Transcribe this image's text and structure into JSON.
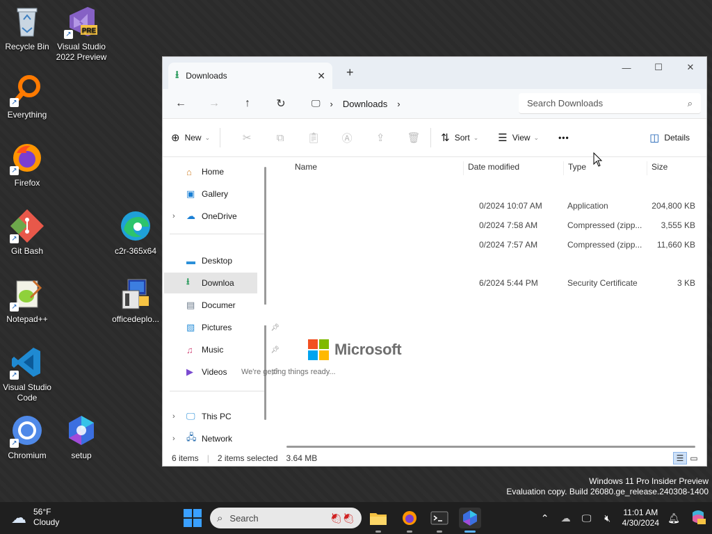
{
  "desktop": {
    "icons": [
      {
        "label": "Recycle Bin",
        "icon": "recycle-bin-icon"
      },
      {
        "label": "Visual Studio 2022 Preview",
        "icon": "visual-studio-icon",
        "badge": "PRE"
      },
      {
        "label": "Everything",
        "icon": "everything-search-icon"
      },
      {
        "label": "Firefox",
        "icon": "firefox-icon"
      },
      {
        "label": "Git Bash",
        "icon": "git-bash-icon"
      },
      {
        "label": "c2r-365x64",
        "icon": "edge-icon"
      },
      {
        "label": "Notepad++",
        "icon": "notepad-plus-plus-icon"
      },
      {
        "label": "officedeplo...",
        "icon": "office-deploy-icon"
      },
      {
        "label": "Visual Studio Code",
        "icon": "vscode-icon"
      },
      {
        "label": "Chromium",
        "icon": "chromium-icon"
      },
      {
        "label": "setup",
        "icon": "setup-icon"
      }
    ],
    "watermark_line1": "Windows 11 Pro Insider Preview",
    "watermark_line2": "Evaluation copy. Build 26080.ge_release.240308-1400"
  },
  "explorer": {
    "tab_title": "Downloads",
    "new_tab": "+",
    "breadcrumb": [
      "Downloads"
    ],
    "search_placeholder": "Search Downloads",
    "toolbar": {
      "new_label": "New",
      "sort_label": "Sort",
      "view_label": "View",
      "more_label": "•••",
      "details_label": "Details"
    },
    "sidebar": [
      {
        "label": "Home",
        "icon": "home-icon"
      },
      {
        "label": "Gallery",
        "icon": "gallery-icon"
      },
      {
        "label": "OneDrive",
        "icon": "onedrive-icon"
      },
      {
        "label": "Desktop",
        "icon": "desktop-folder-icon"
      },
      {
        "label": "Downloa",
        "icon": "downloads-folder-icon"
      },
      {
        "label": "Documer",
        "icon": "documents-folder-icon"
      },
      {
        "label": "Pictures",
        "icon": "pictures-folder-icon"
      },
      {
        "label": "Music",
        "icon": "music-folder-icon"
      },
      {
        "label": "Videos",
        "icon": "videos-folder-icon"
      },
      {
        "label": "This PC",
        "icon": "this-pc-icon"
      },
      {
        "label": "Network",
        "icon": "network-icon"
      }
    ],
    "columns": {
      "name": "Name",
      "date": "Date modified",
      "type": "Type",
      "size": "Size"
    },
    "files": [
      {
        "date": "0/2024 10:07 AM",
        "type": "Application",
        "size": "204,800 KB"
      },
      {
        "date": "0/2024 7:58 AM",
        "type": "Compressed (zipp...",
        "size": "3,555 KB"
      },
      {
        "date": "0/2024 7:57 AM",
        "type": "Compressed (zipp...",
        "size": "11,660 KB"
      },
      {
        "date": "6/2024 5:44 PM",
        "type": "Security Certificate",
        "size": "3 KB"
      }
    ],
    "splash": {
      "brand": "Microsoft",
      "message": "We're getting things ready..."
    },
    "status": {
      "count": "6 items",
      "selected": "2 items selected",
      "size": "3.64 MB"
    }
  },
  "taskbar": {
    "weather_temp": "56°F",
    "weather_desc": "Cloudy",
    "search_label": "Search",
    "clock_time": "11:01 AM",
    "clock_date": "4/30/2024"
  },
  "colors": {
    "accent": "#0067c0",
    "ms_red": "#f25022",
    "ms_green": "#7fba00",
    "ms_blue": "#00a4ef",
    "ms_yellow": "#ffb900"
  }
}
